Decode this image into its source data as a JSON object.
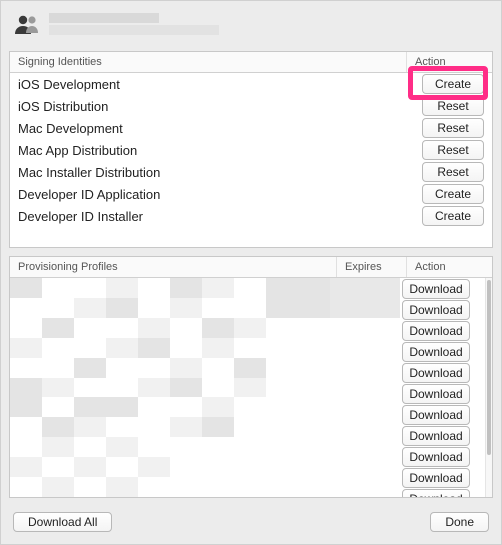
{
  "identities": {
    "header_name": "Signing Identities",
    "header_action": "Action",
    "rows": [
      {
        "name": "iOS Development",
        "action": "Create",
        "highlight": true
      },
      {
        "name": "iOS Distribution",
        "action": "Reset"
      },
      {
        "name": "Mac Development",
        "action": "Reset"
      },
      {
        "name": "Mac App Distribution",
        "action": "Reset"
      },
      {
        "name": "Mac Installer Distribution",
        "action": "Reset"
      },
      {
        "name": "Developer ID Application",
        "action": "Create"
      },
      {
        "name": "Developer ID Installer",
        "action": "Create"
      }
    ]
  },
  "profiles": {
    "header_name": "Provisioning Profiles",
    "header_expires": "Expires",
    "header_action": "Action",
    "actions": [
      "Download",
      "Download",
      "Download",
      "Download",
      "Download",
      "Download",
      "Download",
      "Download",
      "Download",
      "Download",
      "Download"
    ]
  },
  "footer": {
    "download_all": "Download All",
    "done": "Done"
  }
}
